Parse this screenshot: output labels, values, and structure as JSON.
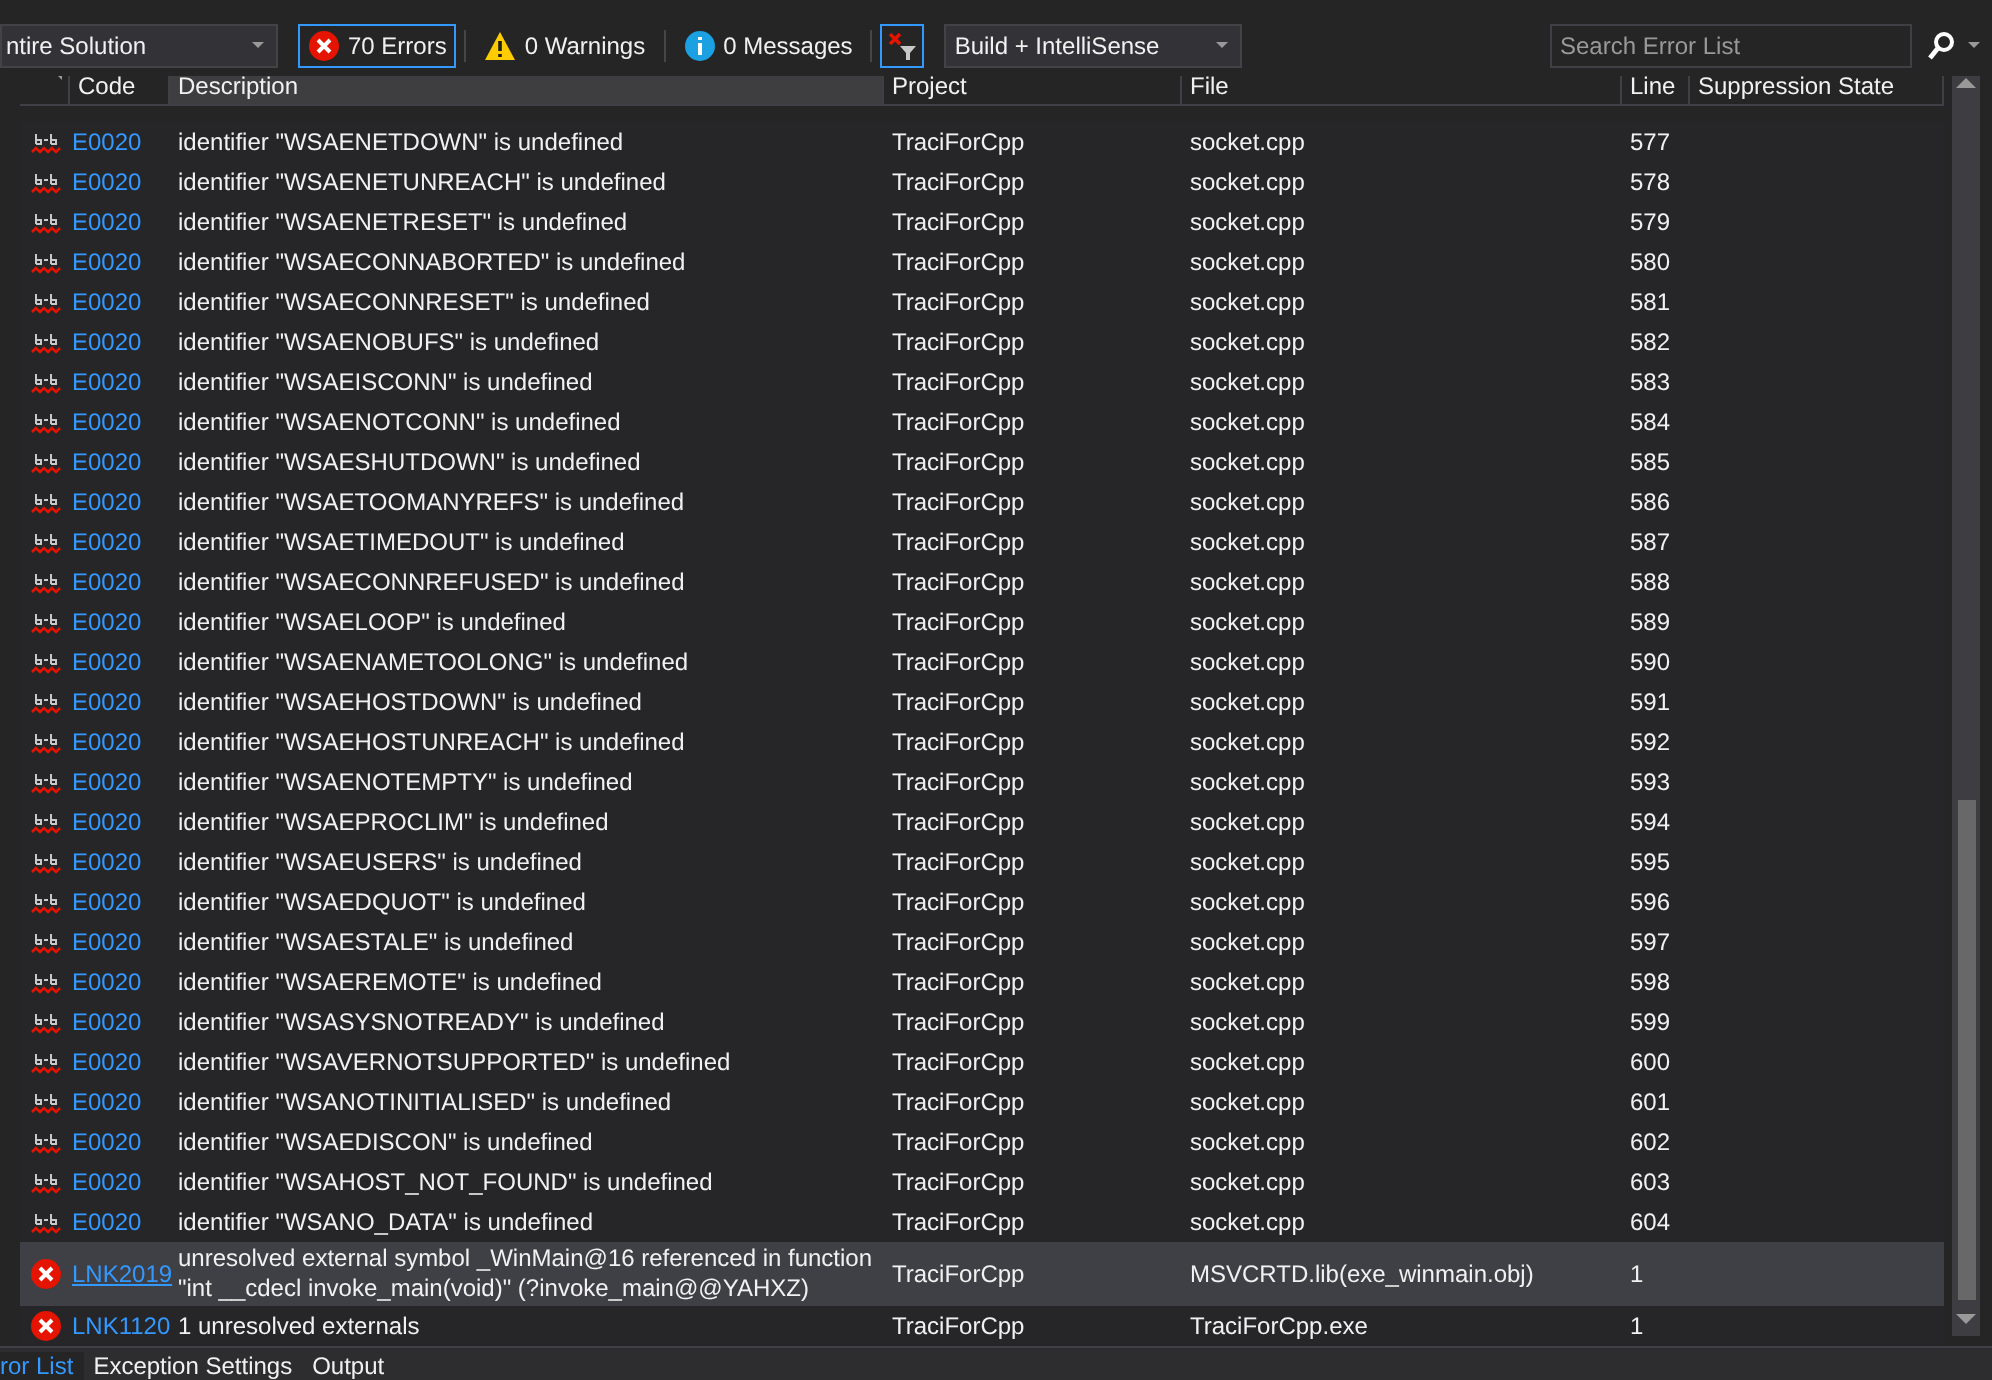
{
  "toolbar": {
    "scope": {
      "value": "ntire Solution"
    },
    "filters": [
      {
        "kind": "error",
        "label": "70 Errors",
        "selected": true
      },
      {
        "kind": "warning",
        "label": "0 Warnings",
        "selected": false
      },
      {
        "kind": "message",
        "label": "0 Messages",
        "selected": false
      }
    ],
    "source": {
      "value": "Build + IntelliSense"
    },
    "search": {
      "placeholder": "Search Error List"
    }
  },
  "table": {
    "columns": [
      "Code",
      "Description",
      "Project",
      "File",
      "Line",
      "Suppression State"
    ],
    "rows": [
      {
        "kind": "intellisense",
        "code": "E0020",
        "description": "identifier \"WSAENETDOWN\" is undefined",
        "project": "TraciForCpp",
        "file": "socket.cpp",
        "line": "577",
        "selected": false
      },
      {
        "kind": "intellisense",
        "code": "E0020",
        "description": "identifier \"WSAENETUNREACH\" is undefined",
        "project": "TraciForCpp",
        "file": "socket.cpp",
        "line": "578",
        "selected": false
      },
      {
        "kind": "intellisense",
        "code": "E0020",
        "description": "identifier \"WSAENETRESET\" is undefined",
        "project": "TraciForCpp",
        "file": "socket.cpp",
        "line": "579",
        "selected": false
      },
      {
        "kind": "intellisense",
        "code": "E0020",
        "description": "identifier \"WSAECONNABORTED\" is undefined",
        "project": "TraciForCpp",
        "file": "socket.cpp",
        "line": "580",
        "selected": false
      },
      {
        "kind": "intellisense",
        "code": "E0020",
        "description": "identifier \"WSAECONNRESET\" is undefined",
        "project": "TraciForCpp",
        "file": "socket.cpp",
        "line": "581",
        "selected": false
      },
      {
        "kind": "intellisense",
        "code": "E0020",
        "description": "identifier \"WSAENOBUFS\" is undefined",
        "project": "TraciForCpp",
        "file": "socket.cpp",
        "line": "582",
        "selected": false
      },
      {
        "kind": "intellisense",
        "code": "E0020",
        "description": "identifier \"WSAEISCONN\" is undefined",
        "project": "TraciForCpp",
        "file": "socket.cpp",
        "line": "583",
        "selected": false
      },
      {
        "kind": "intellisense",
        "code": "E0020",
        "description": "identifier \"WSAENOTCONN\" is undefined",
        "project": "TraciForCpp",
        "file": "socket.cpp",
        "line": "584",
        "selected": false
      },
      {
        "kind": "intellisense",
        "code": "E0020",
        "description": "identifier \"WSAESHUTDOWN\" is undefined",
        "project": "TraciForCpp",
        "file": "socket.cpp",
        "line": "585",
        "selected": false
      },
      {
        "kind": "intellisense",
        "code": "E0020",
        "description": "identifier \"WSAETOOMANYREFS\" is undefined",
        "project": "TraciForCpp",
        "file": "socket.cpp",
        "line": "586",
        "selected": false
      },
      {
        "kind": "intellisense",
        "code": "E0020",
        "description": "identifier \"WSAETIMEDOUT\" is undefined",
        "project": "TraciForCpp",
        "file": "socket.cpp",
        "line": "587",
        "selected": false
      },
      {
        "kind": "intellisense",
        "code": "E0020",
        "description": "identifier \"WSAECONNREFUSED\" is undefined",
        "project": "TraciForCpp",
        "file": "socket.cpp",
        "line": "588",
        "selected": false
      },
      {
        "kind": "intellisense",
        "code": "E0020",
        "description": "identifier \"WSAELOOP\" is undefined",
        "project": "TraciForCpp",
        "file": "socket.cpp",
        "line": "589",
        "selected": false
      },
      {
        "kind": "intellisense",
        "code": "E0020",
        "description": "identifier \"WSAENAMETOOLONG\" is undefined",
        "project": "TraciForCpp",
        "file": "socket.cpp",
        "line": "590",
        "selected": false
      },
      {
        "kind": "intellisense",
        "code": "E0020",
        "description": "identifier \"WSAEHOSTDOWN\" is undefined",
        "project": "TraciForCpp",
        "file": "socket.cpp",
        "line": "591",
        "selected": false
      },
      {
        "kind": "intellisense",
        "code": "E0020",
        "description": "identifier \"WSAEHOSTUNREACH\" is undefined",
        "project": "TraciForCpp",
        "file": "socket.cpp",
        "line": "592",
        "selected": false
      },
      {
        "kind": "intellisense",
        "code": "E0020",
        "description": "identifier \"WSAENOTEMPTY\" is undefined",
        "project": "TraciForCpp",
        "file": "socket.cpp",
        "line": "593",
        "selected": false
      },
      {
        "kind": "intellisense",
        "code": "E0020",
        "description": "identifier \"WSAEPROCLIM\" is undefined",
        "project": "TraciForCpp",
        "file": "socket.cpp",
        "line": "594",
        "selected": false
      },
      {
        "kind": "intellisense",
        "code": "E0020",
        "description": "identifier \"WSAEUSERS\" is undefined",
        "project": "TraciForCpp",
        "file": "socket.cpp",
        "line": "595",
        "selected": false
      },
      {
        "kind": "intellisense",
        "code": "E0020",
        "description": "identifier \"WSAEDQUOT\" is undefined",
        "project": "TraciForCpp",
        "file": "socket.cpp",
        "line": "596",
        "selected": false
      },
      {
        "kind": "intellisense",
        "code": "E0020",
        "description": "identifier \"WSAESTALE\" is undefined",
        "project": "TraciForCpp",
        "file": "socket.cpp",
        "line": "597",
        "selected": false
      },
      {
        "kind": "intellisense",
        "code": "E0020",
        "description": "identifier \"WSAEREMOTE\" is undefined",
        "project": "TraciForCpp",
        "file": "socket.cpp",
        "line": "598",
        "selected": false
      },
      {
        "kind": "intellisense",
        "code": "E0020",
        "description": "identifier \"WSASYSNOTREADY\" is undefined",
        "project": "TraciForCpp",
        "file": "socket.cpp",
        "line": "599",
        "selected": false
      },
      {
        "kind": "intellisense",
        "code": "E0020",
        "description": "identifier \"WSAVERNOTSUPPORTED\" is undefined",
        "project": "TraciForCpp",
        "file": "socket.cpp",
        "line": "600",
        "selected": false
      },
      {
        "kind": "intellisense",
        "code": "E0020",
        "description": "identifier \"WSANOTINITIALISED\" is undefined",
        "project": "TraciForCpp",
        "file": "socket.cpp",
        "line": "601",
        "selected": false
      },
      {
        "kind": "intellisense",
        "code": "E0020",
        "description": "identifier \"WSAEDISCON\" is undefined",
        "project": "TraciForCpp",
        "file": "socket.cpp",
        "line": "602",
        "selected": false
      },
      {
        "kind": "intellisense",
        "code": "E0020",
        "description": "identifier \"WSAHOST_NOT_FOUND\" is undefined",
        "project": "TraciForCpp",
        "file": "socket.cpp",
        "line": "603",
        "selected": false
      },
      {
        "kind": "intellisense",
        "code": "E0020",
        "description": "identifier \"WSANO_DATA\" is undefined",
        "project": "TraciForCpp",
        "file": "socket.cpp",
        "line": "604",
        "selected": false
      },
      {
        "kind": "build",
        "code": "LNK2019",
        "description": "unresolved external symbol _WinMain@16 referenced in function \"int __cdecl invoke_main(void)\" (?invoke_main@@YAHXZ)",
        "project": "TraciForCpp",
        "file": "MSVCRTD.lib(exe_winmain.obj)",
        "line": "1",
        "selected": true
      },
      {
        "kind": "build",
        "code": "LNK1120",
        "description": "1 unresolved externals",
        "project": "TraciForCpp",
        "file": "TraciForCpp.exe",
        "line": "1",
        "selected": false
      }
    ]
  },
  "tabs": [
    {
      "label": "ror List",
      "selected": true
    },
    {
      "label": "Exception Settings",
      "selected": false
    },
    {
      "label": "Output",
      "selected": false
    }
  ]
}
